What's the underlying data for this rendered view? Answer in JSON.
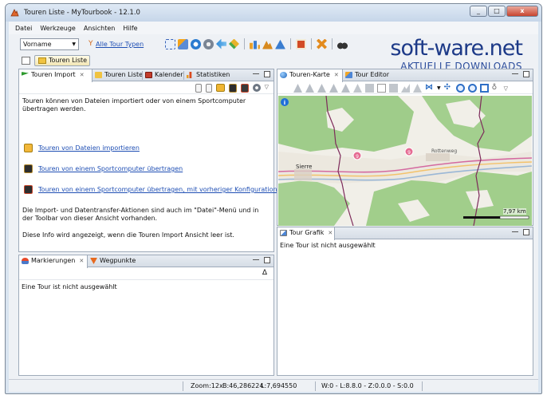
{
  "window": {
    "title": "Touren Liste - MyTourbook - 12.1.0",
    "controls": [
      "_",
      "□",
      "x"
    ]
  },
  "menubar": [
    "Datei",
    "Werkzeuge",
    "Ansichten",
    "Hilfe"
  ],
  "toolbar": {
    "name_select": "Vorname",
    "filter_link": "Alle Tour Typen"
  },
  "perspective": {
    "label": "Touren Liste"
  },
  "left_top_pane": {
    "tabs": [
      "Touren Import",
      "Touren Liste",
      "Kalender",
      "Statistiken"
    ],
    "intro": "Touren können von Dateien importiert oder von einem Sportcomputer übertragen werden.",
    "links": [
      "Touren von Dateien importieren",
      "Touren von einem Sportcomputer übertragen",
      "Touren von einem Sportcomputer übertragen, mit vorheriger Konfiguration"
    ],
    "info1": "Die Import- und Datentransfer-Aktionen sind auch im \"Datei\"-Menü und in der Toolbar von dieser Ansicht vorhanden.",
    "info2": "Diese Info wird angezeigt, wenn die Touren Import Ansicht leer ist."
  },
  "left_bottom_pane": {
    "tabs": [
      "Markierungen",
      "Wegpunkte"
    ],
    "sort_glyph": "Δ",
    "message": "Eine Tour ist nicht ausgewählt"
  },
  "right_top_pane": {
    "tabs": [
      "Touren-Karte",
      "Tour Editor"
    ],
    "scale": "7,97 km",
    "map_labels": {
      "town": "Sierre",
      "road": "Rottenweg"
    }
  },
  "right_bottom_pane": {
    "tabs": [
      "Tour Grafik"
    ],
    "message": "Eine Tour ist nicht ausgewählt"
  },
  "statusbar": {
    "zoom": "Zoom:12x",
    "lat": "B:46,286224",
    "lon": "L:7,694550",
    "tile": "W:0 - L:8.8.0 - Z:0.0.0 - S:0.0"
  },
  "watermark": {
    "main": "soft-ware.net",
    "sub": "AKTUELLE DOWNLOADS"
  },
  "colors": {
    "link": "#1f4fb4",
    "map_green": "#9dc98b",
    "map_bg": "#f2efe9",
    "track": "#7d2a5a"
  }
}
